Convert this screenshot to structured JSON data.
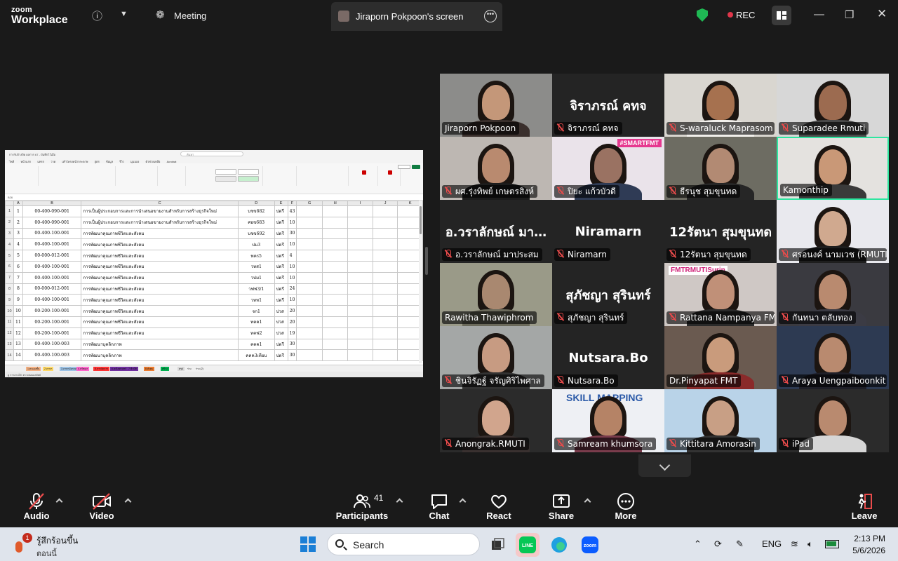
{
  "app": {
    "brand_top": "zoom",
    "brand_bottom": "Workplace",
    "meeting_label": "Meeting",
    "share_label": "Jiraporn Pokpoon's screen",
    "rec_label": "REC"
  },
  "sheet": {
    "title": "การรับจ้างปิด  ผลการ 67 - บันทึกไว้เมื่อ",
    "search_placeholder": "ค้นหา",
    "menu": [
      "ไฟล์",
      "หน้าแรก",
      "แทรก",
      "วาด",
      "เค้าโครงหน้ากระดาษ",
      "สูตร",
      "ข้อมูล",
      "รีวิว",
      "มุมมอง",
      "ตัวช่วยเหลือ",
      "Acrobat"
    ],
    "cell_ref": "B26",
    "columns": [
      "",
      "A",
      "B",
      "C",
      "D",
      "E",
      "F",
      "G",
      "H",
      "I",
      "J",
      "K"
    ],
    "rows": [
      {
        "n": "1",
        "a": "1",
        "b": "00-400-090-001",
        "c": "การเป็นผู้ประกอบการและการนำเสนอขายงานสำหรับการสร้างธุรกิจใหม่",
        "d": "บชข682",
        "e": "ปตรี",
        "f": "43"
      },
      {
        "n": "2",
        "a": "2",
        "b": "00-400-090-001",
        "c": "การเป็นผู้ประกอบการและการนำเสนอขายงานสำหรับการสร้างธุรกิจใหม่",
        "d": "ศอข683",
        "e": "ปตรี",
        "f": "10"
      },
      {
        "n": "3",
        "a": "3",
        "b": "00-400-100-001",
        "c": "การพัฒนาคุณภาพชีวิตและสังคม",
        "d": "บชข692",
        "e": "ปตรี",
        "f": "30"
      },
      {
        "n": "4",
        "a": "4",
        "b": "00-400-100-001",
        "c": "การพัฒนาคุณภาพชีวิตและสังคม",
        "d": "ปม3",
        "e": "ปตรี",
        "f": "10"
      },
      {
        "n": "5",
        "a": "5",
        "b": "00-000-012-001",
        "c": "การพัฒนาคุณภาพชีวิตและสังคม",
        "d": "พคร5",
        "e": "ปตรี",
        "f": "4"
      },
      {
        "n": "6",
        "a": "6",
        "b": "00-400-100-001",
        "c": "การพัฒนาคุณภาพชีวิตและสังคม",
        "d": "วทส1",
        "e": "ปตรี",
        "f": "10"
      },
      {
        "n": "7",
        "a": "7",
        "b": "00-400-100-001",
        "c": "การพัฒนาคุณภาพชีวิตและสังคม",
        "d": "วปม1",
        "e": "ปตรี",
        "f": "10"
      },
      {
        "n": "8",
        "a": "8",
        "b": "00-000-012-001",
        "c": "การพัฒนาคุณภาพชีวิตและสังคม",
        "d": "วฟฟ3/1",
        "e": "ปตรี",
        "f": "24"
      },
      {
        "n": "9",
        "a": "9",
        "b": "00-400-100-001",
        "c": "การพัฒนาคุณภาพชีวิตและสังคม",
        "d": "วทท1",
        "e": "ปตรี",
        "f": "10"
      },
      {
        "n": "10",
        "a": "10",
        "b": "00-200-100-001",
        "c": "การพัฒนาคุณภาพชีวิตและสังคม",
        "d": "จก1",
        "e": "ปวส",
        "f": "20"
      },
      {
        "n": "11",
        "a": "11",
        "b": "00-200-100-001",
        "c": "การพัฒนาคุณภาพชีวิตและสังคม",
        "d": "ทคค1",
        "e": "ปวส",
        "f": "20"
      },
      {
        "n": "12",
        "a": "12",
        "b": "00-200-100-001",
        "c": "การพัฒนาคุณภาพชีวิตและสังคม",
        "d": "ทคฟ2",
        "e": "ปวส",
        "f": "19"
      },
      {
        "n": "13",
        "a": "13",
        "b": "00-400-100-003",
        "c": "การพัฒนาบุคลิกภาพ",
        "d": "คคค1",
        "e": "ปตรี",
        "f": "30"
      },
      {
        "n": "14",
        "a": "14",
        "b": "00-400-100-003",
        "c": "การพัฒนาบุคลิกภาพ",
        "d": "คคค3เทียบ",
        "e": "ปตรี",
        "f": "30"
      }
    ],
    "tabs": [
      {
        "label": "1.ตนเองชั้น",
        "color": "#f4b183"
      },
      {
        "label": "2.ภาษา",
        "color": "#ffd966"
      },
      {
        "label": "3.ภาษาอังกฤษ",
        "color": "#9dc3e6"
      },
      {
        "label": "4.ปรัชญา",
        "color": "#ff66cc"
      },
      {
        "label": "5.การจัดการ",
        "color": "#ff3333"
      },
      {
        "label": "6.คณิตศาสตร์",
        "color": "#7030a0"
      },
      {
        "label": "7.ชีวมิติ",
        "color": "#7030a0"
      },
      {
        "label": "8.สังคม",
        "color": "#ed7d31"
      },
      {
        "label": "สร้าง",
        "color": "#00b050"
      },
      {
        "label": "สรุป",
        "color": "#d9d9d9"
      },
      {
        "label": "ร่าง",
        "color": "#f0f0f0"
      },
      {
        "label": "ร่าง (2)",
        "color": "#f0f0f0"
      }
    ],
    "status": "ดู การอ่านได้: ตรวจสอบผลลัพธ์"
  },
  "participants": [
    {
      "name": "Jiraporn Pokpoon",
      "big": "",
      "muted": false,
      "bg": "#8c8c8a",
      "skin": "#c49779",
      "shirt": "#3a2f2c",
      "active": false
    },
    {
      "name": "จิราภรณ์ คทจ",
      "big": "จิราภรณ์ คทจ",
      "muted": true,
      "bg": "#242424",
      "active": false
    },
    {
      "name": "S-waraluck Maprasom",
      "big": "",
      "muted": true,
      "bg": "#d9d6d0",
      "skin": "#a6714f",
      "shirt": "#f2f0ec",
      "active": false
    },
    {
      "name": "Suparadee Rmuti",
      "big": "",
      "muted": true,
      "bg": "#d7d7d7",
      "skin": "#9c6b50",
      "shirt": "#4a4a4a",
      "active": false
    },
    {
      "name": "ผศ.รุ่งทิพย์ เกษตรสิงห์",
      "big": "",
      "muted": true,
      "bg": "#bdb7b2",
      "skin": "#b98a6f",
      "shirt": "#1c1c1c",
      "active": false
    },
    {
      "name": "ปิยะ แก้วบัวดี",
      "big": "",
      "muted": true,
      "bg": "#eae3ea",
      "skin": "#9a7262",
      "shirt": "#2f3b55",
      "active": false
    },
    {
      "name": "ธีรนุช สุมขุนทด",
      "big": "",
      "muted": true,
      "bg": "#6d6c62",
      "skin": "#b28a73",
      "shirt": "#262626",
      "active": false
    },
    {
      "name": "Kamonthip",
      "big": "",
      "muted": false,
      "bg": "#e4e2df",
      "skin": "#c99877",
      "shirt": "#3a3a3a",
      "active": true
    },
    {
      "name": "อ.วราลักษณ์ มาประสม",
      "big": "อ.วราลักษณ์ มา…",
      "muted": true,
      "bg": "#242424",
      "active": false
    },
    {
      "name": "Niramarn",
      "big": "Niramarn",
      "muted": true,
      "bg": "#242424",
      "active": false
    },
    {
      "name": "12รัตนา สุมขุนทด",
      "big": "12รัตนา สุมขุนทด",
      "muted": true,
      "bg": "#242424",
      "active": false
    },
    {
      "name": "ศรอนงค์ นามเวช (RMUTI…",
      "big": "",
      "muted": true,
      "bg": "#e9e9ee",
      "skin": "#d0a98f",
      "shirt": "#1e1e1e",
      "active": false
    },
    {
      "name": "Rawitha Thawiphrom",
      "big": "",
      "muted": false,
      "bg": "#9a9a88",
      "skin": "#a98870",
      "shirt": "#6b6a5b",
      "active": false
    },
    {
      "name": "สุภัชญา สุรินทร์",
      "big": "สุภัชญา สุรินทร์",
      "muted": true,
      "bg": "#242424",
      "active": false
    },
    {
      "name": "Rattana Nampanya FM…",
      "big": "",
      "muted": true,
      "bg": "#cfc8c5",
      "skin": "#c09078",
      "shirt": "#2a2a2a",
      "active": false
    },
    {
      "name": "กันทนา ตลับทอง",
      "big": "",
      "muted": true,
      "bg": "#3a3a40",
      "skin": "#b98a6f",
      "shirt": "#3b3b44",
      "active": false
    },
    {
      "name": "ชินจิรัฏฐ์ จรัญศิริไพศาล",
      "big": "",
      "muted": true,
      "bg": "#a4a7a6",
      "skin": "#c79b82",
      "shirt": "#333",
      "active": false
    },
    {
      "name": "Nutsara.Bo",
      "big": "Nutsara.Bo",
      "muted": true,
      "bg": "#242424",
      "active": false
    },
    {
      "name": "Dr.Pinyapat FMT",
      "big": "",
      "muted": false,
      "bg": "#6a5a50",
      "skin": "#c99b7c",
      "shirt": "#8a2a2a",
      "active": false
    },
    {
      "name": "Araya Uengpaiboonkit",
      "big": "",
      "muted": true,
      "bg": "#2d3a52",
      "skin": "#b98a6f",
      "shirt": "#1f1f28",
      "active": false
    },
    {
      "name": "Anongrak.RMUTI",
      "big": "",
      "muted": true,
      "bg": "#2b2b2b",
      "skin": "#d1a58d",
      "shirt": "#3a3130",
      "active": false
    },
    {
      "name": "Samream khumsora",
      "big": "",
      "muted": true,
      "bg": "#eef0f4",
      "skin": "#b58366",
      "shirt": "#7a3c4c",
      "active": false
    },
    {
      "name": "Kittitara Amorasin",
      "big": "",
      "muted": true,
      "bg": "#b9d3e8",
      "skin": "#c89f85",
      "shirt": "#333",
      "active": false
    },
    {
      "name": "iPad",
      "big": "",
      "muted": true,
      "bg": "#2b2b2b",
      "skin": "#b98a6f",
      "shirt": "#d6d6d6",
      "active": false
    }
  ],
  "gallery_extras": {
    "banner_smartfmt": "#SMARTFMT",
    "banner_fmt_surin": "FMTRMUTISurin",
    "banner_skill": "SKILL MAPPING"
  },
  "toolbar": {
    "audio": "Audio",
    "video": "Video",
    "participants": "Participants",
    "participant_count": "41",
    "chat": "Chat",
    "react": "React",
    "share": "Share",
    "more": "More",
    "leave": "Leave"
  },
  "taskbar": {
    "weather_title": "รู้สึกร้อนขึ้น",
    "weather_sub": "ตอนนี้",
    "weather_badge": "1",
    "search": "Search",
    "lang": "ENG",
    "time": "2:13 PM",
    "date": "5/6/2026"
  },
  "colors": {
    "accent_green": "#2ee6a0",
    "rec_red": "#e0364a",
    "muted_red": "#e94b4b",
    "shield_green": "#1fb954"
  }
}
